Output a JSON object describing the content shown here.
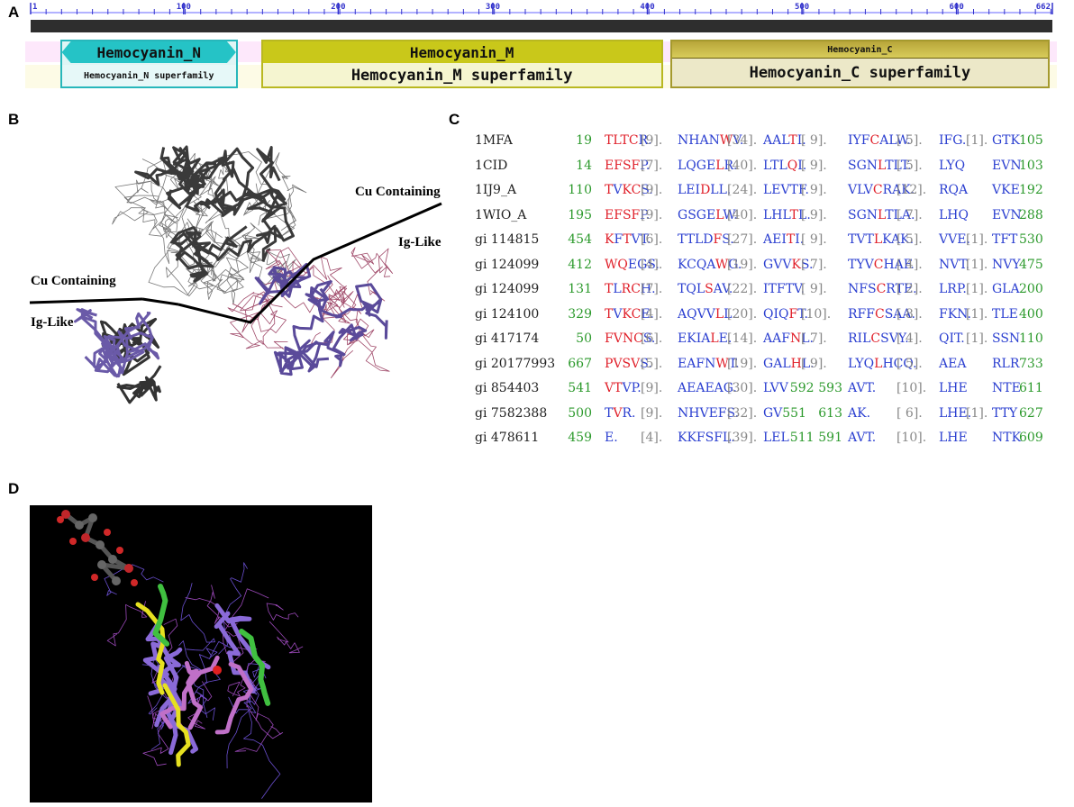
{
  "panels": {
    "a": "A",
    "b": "B",
    "c": "C",
    "d": "D"
  },
  "ruler": {
    "min": 1,
    "max": 662,
    "ticks": [
      {
        "v": 1,
        "label": "1"
      },
      {
        "v": 100,
        "label": "100"
      },
      {
        "v": 200,
        "label": "200"
      },
      {
        "v": 300,
        "label": "300"
      },
      {
        "v": 400,
        "label": "400"
      },
      {
        "v": 500,
        "label": "500"
      },
      {
        "v": 600,
        "label": "600"
      },
      {
        "v": 662,
        "label": "662"
      }
    ]
  },
  "domains": [
    {
      "name": "Hemocyanin_N",
      "superfamily": "Hemocyanin_N superfamily",
      "start": 20,
      "end": 135,
      "color_top": "#25c3c6",
      "color_bot": "#dff5f5",
      "border": "#27b7bb"
    },
    {
      "name": "Hemocyanin_M",
      "superfamily": "Hemocyanin_M superfamily",
      "start": 150,
      "end": 410,
      "color_top": "#c9c81a",
      "color_bot": "#f5f5d0",
      "border": "#b9b820"
    },
    {
      "name": "Hemocyanin_C",
      "superfamily": "Hemocyanin_C superfamily",
      "start": 415,
      "end": 660,
      "color_top": "#9c8c1c",
      "color_bot": "#ece8c8",
      "border": "#a59a2e"
    }
  ],
  "structure": {
    "labels": {
      "cu_right": "Cu Containing",
      "ig_right": "Ig-Like",
      "cu_left": "Cu Containing",
      "ig_left": "Ig-Like"
    }
  },
  "alignment": [
    {
      "id": "1MFA",
      "start": "19",
      "m1": "TLTCR.",
      "g1": "[9].",
      "m2": "NHANWV.",
      "g2": "[34].",
      "m3": "AALTI.",
      "g3": "[ 9].",
      "m4": "IYFCALW.",
      "g4": "[ 5].",
      "m5": "IFG.",
      "g5": "[1].",
      "m6": "GTK",
      "end": "105"
    },
    {
      "id": "1CID",
      "start": "14",
      "m1": "EFSFP.",
      "g1": "[7].",
      "m2": "LQGELR.",
      "g2": "[40].",
      "m3": "LTLQI.",
      "g3": "[ 9].",
      "m4": "SGNLTLT.",
      "g4": "[ 5].",
      "m5": "LYQ",
      "g5": "",
      "m6": "EVN",
      "end": "103"
    },
    {
      "id": "1IJ9_A",
      "start": "110",
      "m1": "TVKCS.",
      "g1": "[9].",
      "m2": "LEIDLL.",
      "g2": "[24].",
      "m3": "LEVTF.",
      "g3": "[ 9].",
      "m4": "VLVCRAK.",
      "g4": "[12].",
      "m5": "RQA",
      "g5": "",
      "m6": "VKE",
      "end": "192"
    },
    {
      "id": "1WIO_A",
      "start": "195",
      "m1": "EFSFP.",
      "g1": "[9].",
      "m2": "GSGELW.",
      "g2": "[40].",
      "m3": "LHLTL.",
      "g3": "[ 9].",
      "m4": "SGNLTLA.",
      "g4": "[ 7].",
      "m5": "LHQ",
      "g5": "",
      "m6": "EVN",
      "end": "288"
    },
    {
      "id": "gi 114815",
      "start": "454",
      "m1": "KFTVT.",
      "g1": "[6].",
      "m2": "TTLDFS.",
      "g2": "[27].",
      "m3": "AEITI.",
      "g3": "[ 9].",
      "m4": "TVTLKAK.",
      "g4": "[ 5].",
      "m5": "VVE.",
      "g5": "[1].",
      "m6": "TFT",
      "end": "530"
    },
    {
      "id": "gi 124099",
      "start": "412",
      "m1": "WQEGS.",
      "g1": "[4].",
      "m2": "KCQAWG.",
      "g2": "[19].",
      "m3": "GVVKS.",
      "g3": "[ 7].",
      "m4": "TYVCHAF.",
      "g4": "[ 4].",
      "m5": "NVT.",
      "g5": "[1].",
      "m6": "NVY",
      "end": "475"
    },
    {
      "id": "gi 124099",
      "start": "131",
      "m1": "TLRCH.",
      "g1": "[7].",
      "m2": "TQLSAV.",
      "g2": "[22].",
      "m3": "ITFTV.",
      "g3": "[ 9].",
      "m4": "NFSCRTE.",
      "g4": "[ 2].",
      "m5": "LRP.",
      "g5": "[1].",
      "m6": "GLA",
      "end": "200"
    },
    {
      "id": "gi 124100",
      "start": "329",
      "m1": "TVKCE.",
      "g1": "[4].",
      "m2": "AQVVLL.",
      "g2": "[20].",
      "m3": "QIQFT.",
      "g3": "[10].",
      "m4": "RFFCSAA.",
      "g4": "[ 8].",
      "m5": "FKN.",
      "g5": "[1].",
      "m6": "TLE",
      "end": "400"
    },
    {
      "id": "gi 417174",
      "start": "50",
      "m1": "FVNCS.",
      "g1": "[6].",
      "m2": "EKIALE.",
      "g2": "[14].",
      "m3": "AAFNL.",
      "g3": "[ 7].",
      "m4": "RILCSVY.",
      "g4": "[ 4].",
      "m5": "QIT.",
      "g5": "[1].",
      "m6": "SSN",
      "end": "110"
    },
    {
      "id": "gi 20177993",
      "start": "667",
      "m1": "PVSVS.",
      "g1": "[5].",
      "m2": "EAFNWT.",
      "g2": "[19].",
      "m3": "GALHL.",
      "g3": "[ 9].",
      "m4": "LYQLHCQ.",
      "g4": "[ 5].",
      "m5": "AEA",
      "g5": "",
      "m6": "RLR",
      "end": "733"
    },
    {
      "id": "gi 854403",
      "start": "541",
      "m1": "VTVP.",
      "g1": "[9].",
      "m2": "AEAEAG.",
      "g2": "[30].",
      "m3": "LVV",
      "mid_a": "592",
      "mid_b": "593",
      "m4": "AVT.",
      "g4": "[10].",
      "m5": "LHE",
      "g5": "",
      "m6": "NTE",
      "end": "611"
    },
    {
      "id": "gi 7582388",
      "start": "500",
      "m1": "TVR.",
      "g1": "[9].",
      "m2": "NHVEFS.",
      "g2": "[32].",
      "m3": "GV",
      "mid_a": "551",
      "mid_b": "613",
      "m4": "AK.",
      "g4": "[ 6].",
      "m5": "LHE.",
      "g5": "[1].",
      "m6": "TTY",
      "end": "627"
    },
    {
      "id": "gi 478611",
      "start": "459",
      "m1": "E.",
      "g1": "[4].",
      "m2": "KKFSFL.",
      "g2": "[39].",
      "m3": "LEL",
      "mid_a": "511",
      "mid_b": "591",
      "m4": "AVT.",
      "g4": "[10].",
      "m5": "LHE",
      "g5": "",
      "m6": "NTK",
      "end": "609"
    }
  ],
  "colors": {
    "number": "#2d9a2d",
    "residue": "#2b3fd0",
    "gap": "#888888",
    "conserved": "#e0202a"
  }
}
